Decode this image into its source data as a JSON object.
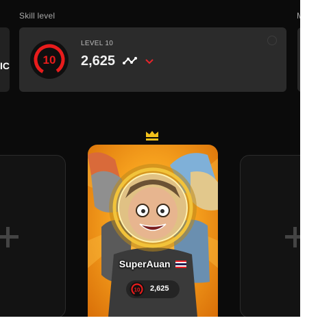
{
  "skill_section": {
    "label": "Skill level",
    "level_label": "LEVEL 10",
    "elo": "2,625",
    "badge_level": "10",
    "badge_color": "#e81c1c",
    "trend_icon": "trend-graph-icon",
    "chevron_icon": "chevron-down-icon",
    "chevron_color": "#e8242b"
  },
  "neighbor_cards": {
    "left_fragment": "IC",
    "right_label_fragment": "M"
  },
  "party": {
    "leader_icon": "crown-icon",
    "crown_color": "#f3c21b",
    "player": {
      "name": "SuperAuan",
      "country_flag": "thailand-flag-icon",
      "level": "10",
      "elo": "2,625"
    },
    "empty_slot_icon": "plus-icon"
  }
}
